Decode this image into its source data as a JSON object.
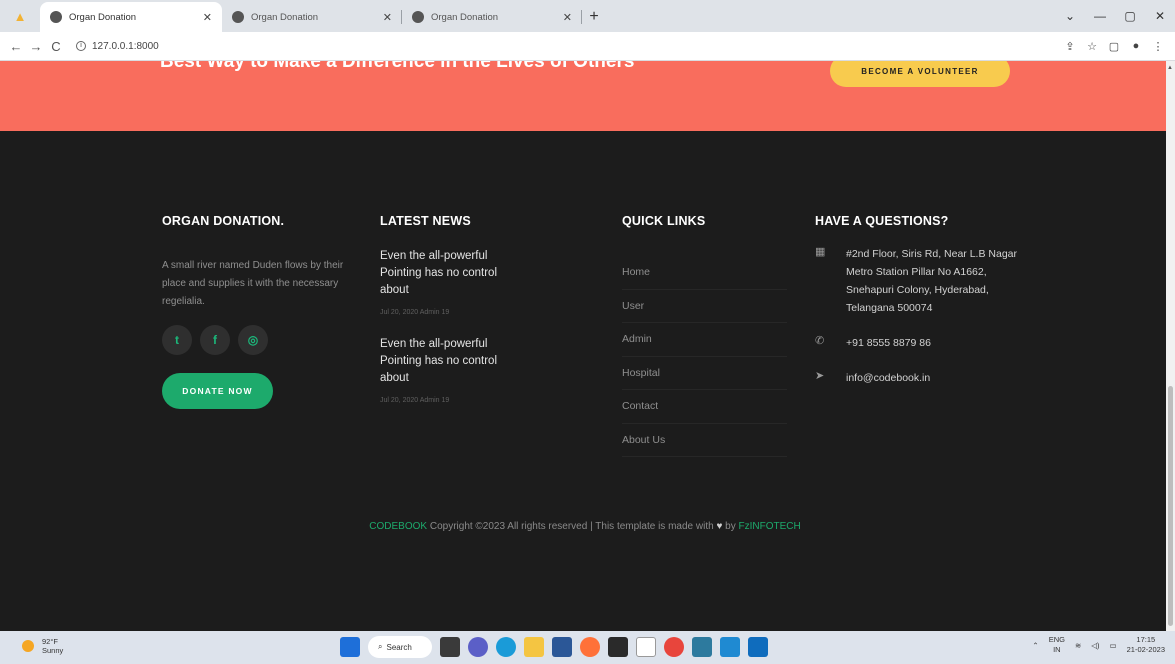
{
  "browser": {
    "tabs": [
      {
        "title": "Organ Donation",
        "active": true
      },
      {
        "title": "Organ Donation",
        "active": false
      },
      {
        "title": "Organ Donation",
        "active": false
      }
    ],
    "new_tab": "+",
    "close": "✕",
    "url": "127.0.0.1:8000",
    "window_controls": [
      "⌄",
      "—",
      "▢",
      "✕"
    ]
  },
  "cta": {
    "title": "Best Way to Make a Difference in the Lives of Others",
    "button": "BECOME A VOLUNTEER"
  },
  "footer": {
    "about": {
      "title": "ORGAN DONATION.",
      "text": "A small river named Duden flows by their place and supplies it with the necessary regelialia.",
      "social": [
        "twitter-icon",
        "facebook-icon",
        "instagram-icon"
      ],
      "donate_label": "DONATE NOW"
    },
    "news": {
      "title": "LATEST NEWS",
      "items": [
        {
          "title": "Even the all-powerful Pointing has no control about",
          "meta": "Jul 20, 2020  Admin  19"
        },
        {
          "title": "Even the all-powerful Pointing has no control about",
          "meta": "Jul 20, 2020  Admin  19"
        }
      ]
    },
    "links": {
      "title": "QUICK LINKS",
      "items": [
        "Home",
        "User",
        "Admin",
        "Hospital",
        "Contact",
        "About Us"
      ]
    },
    "contact": {
      "title": "HAVE A QUESTIONS?",
      "address": "#2nd Floor, Siris Rd, Near L.B Nagar Metro Station Pillar No A1662, Snehapuri Colony, Hyderabad, Telangana 500074",
      "phone": "+91 8555 8879 86",
      "email": "info@codebook.in"
    },
    "copyright": {
      "brand": "CODEBOOK",
      "text": " Copyright ©2023 All rights reserved | This template is made with ",
      "heart": "♥",
      "by": " by ",
      "author": "FzINFOTECH"
    }
  },
  "taskbar": {
    "weather_temp": "92°F",
    "weather_desc": "Sunny",
    "search_label": "Search",
    "lang_top": "ENG",
    "lang_bottom": "IN",
    "time": "17:15",
    "date": "21-02-2023"
  },
  "colors": {
    "cta_band": "#f96d5d",
    "volunteer": "#f8cb4e",
    "accent_green": "#1daa6c",
    "footer_bg": "#1c1c1c"
  }
}
